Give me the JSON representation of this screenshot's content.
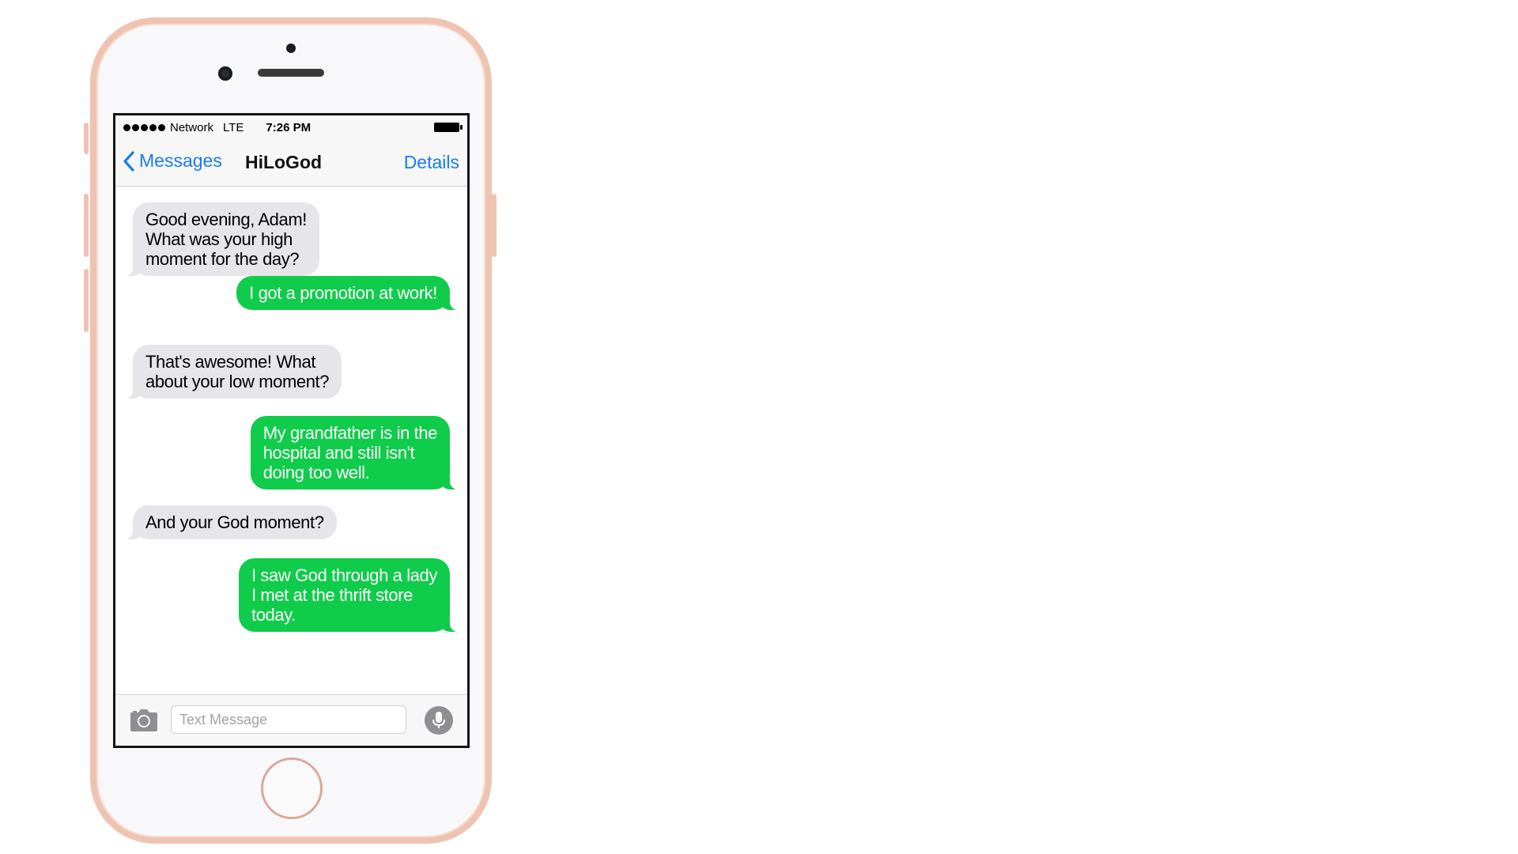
{
  "status_bar": {
    "carrier": "Network",
    "network_type": "LTE",
    "time": "7:26 PM",
    "signal_dots": 5
  },
  "nav": {
    "back_label": "Messages",
    "title": "HiLoGod",
    "details_label": "Details"
  },
  "messages": [
    {
      "direction": "in",
      "text": "Good evening, Adam!\nWhat was your high\nmoment for the day?"
    },
    {
      "direction": "out",
      "text": "I got a promotion at work!"
    },
    {
      "direction": "in",
      "text": "That's awesome! What\nabout your low moment?"
    },
    {
      "direction": "out",
      "text": "My grandfather is in the\nhospital and still isn't\ndoing too well."
    },
    {
      "direction": "in",
      "text": "And your God moment?"
    },
    {
      "direction": "out",
      "text": "I saw God through a lady\nI met at the thrift store\ntoday."
    }
  ],
  "composer": {
    "placeholder": "Text Message",
    "camera_icon": "camera-icon",
    "mic_icon": "microphone-icon"
  },
  "colors": {
    "incoming_bubble": "#e5e5ea",
    "outgoing_bubble": "#0fcc4a",
    "ios_blue": "#1a7bf2",
    "phone_frame": "#efc3b1"
  }
}
